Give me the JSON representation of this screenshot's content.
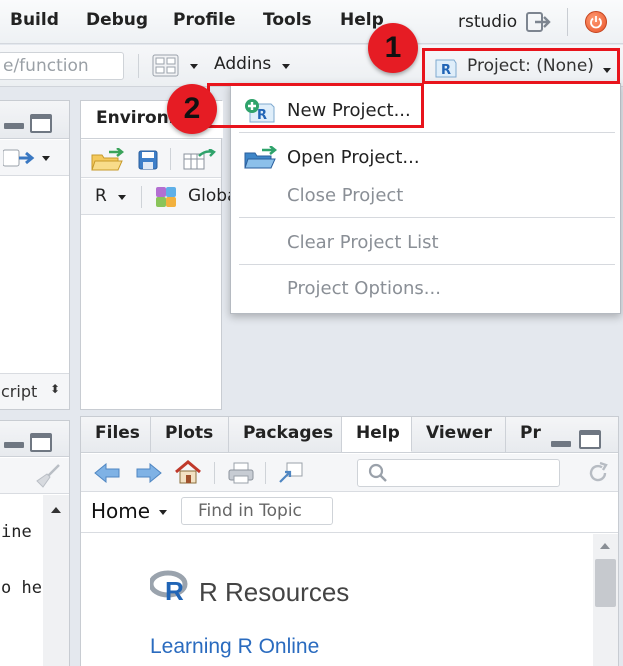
{
  "menubar": {
    "items": [
      "Build",
      "Debug",
      "Profile",
      "Tools",
      "Help"
    ],
    "user": "rstudio"
  },
  "toolbar": {
    "goto_placeholder": "e/function",
    "addins_label": "Addins",
    "project_label": "Project: (None)"
  },
  "left_pane": {
    "source_select": "cript",
    "console_lines": [
      "ine",
      "o he"
    ]
  },
  "env_pane": {
    "tab_label": "Environm",
    "r_label": "R",
    "global_label": "Globa"
  },
  "project_menu": {
    "items": [
      {
        "label": "New Project...",
        "enabled": true
      },
      {
        "label": "Open Project...",
        "enabled": true
      },
      {
        "label": "Close Project",
        "enabled": false
      },
      {
        "label": "Clear Project List",
        "enabled": false
      },
      {
        "label": "Project Options...",
        "enabled": false
      }
    ]
  },
  "callouts": {
    "first": "1",
    "second": "2"
  },
  "help_pane": {
    "tabs": [
      "Files",
      "Plots",
      "Packages",
      "Help",
      "Viewer",
      "Pr"
    ],
    "active_tab": "Help",
    "home_label": "Home",
    "find_placeholder": "Find in Topic",
    "heading": "R Resources",
    "link": "Learning R Online"
  },
  "colors": {
    "accent_red": "#e61c24",
    "link_blue": "#2a6bbf",
    "r_logo_blue": "#2165b6"
  }
}
